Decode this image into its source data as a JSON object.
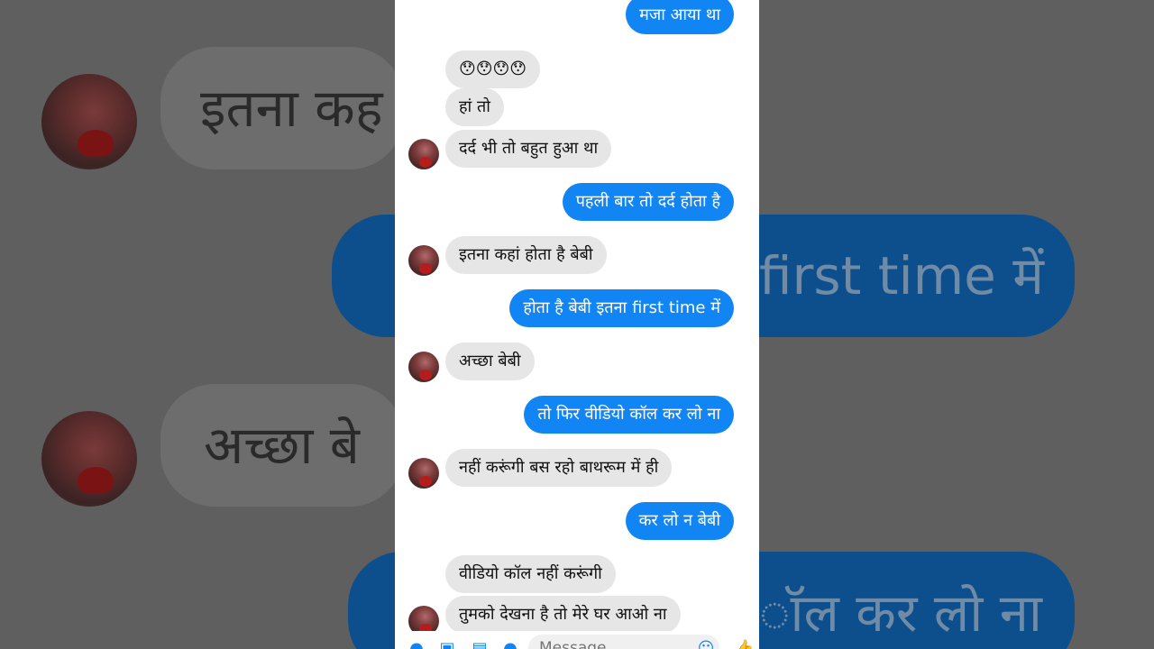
{
  "background": {
    "left_bubble_1": "इतना कह",
    "right_bubble_1": "first time में",
    "left_bubble_2": "अच्छा बे",
    "right_bubble_2": "ॉल कर लो ना"
  },
  "chat": {
    "messages": [
      {
        "id": "m1",
        "side": "out",
        "text": "मजा आया था"
      },
      {
        "id": "m2",
        "side": "in",
        "text": "😯😯😯😯"
      },
      {
        "id": "m3",
        "side": "in",
        "text": "हां तो"
      },
      {
        "id": "m4",
        "side": "in",
        "text": "दर्द भी तो बहुत हुआ था"
      },
      {
        "id": "m5",
        "side": "out",
        "text": "पहली बार तो दर्द होता है"
      },
      {
        "id": "m6",
        "side": "in",
        "text": "इतना कहां होता है बेबी"
      },
      {
        "id": "m7",
        "side": "out",
        "text": "होता है बेबी इतना first time में"
      },
      {
        "id": "m8",
        "side": "in",
        "text": "अच्छा बेबी"
      },
      {
        "id": "m9",
        "side": "out",
        "text": "तो फिर वीडियो कॉल कर लो ना"
      },
      {
        "id": "m10",
        "side": "in",
        "text": "नहीं करूंगी बस रहो बाथरूम में ही"
      },
      {
        "id": "m11",
        "side": "out",
        "text": "कर लो न बेबी"
      },
      {
        "id": "m12",
        "side": "in",
        "text": "वीडियो कॉल नहीं करूंगी"
      },
      {
        "id": "m13",
        "side": "in",
        "text": "तुमको देखना है तो मेरे घर आओ ना"
      }
    ]
  },
  "composer": {
    "placeholder": "Message",
    "icons": [
      "apps-icon",
      "camera-icon",
      "image-icon",
      "mic-icon",
      "emoji-icon",
      "like-icon"
    ]
  },
  "colors": {
    "outgoing": "#1285f5",
    "incoming": "#e6e6e6",
    "accent": "#1285f5"
  }
}
